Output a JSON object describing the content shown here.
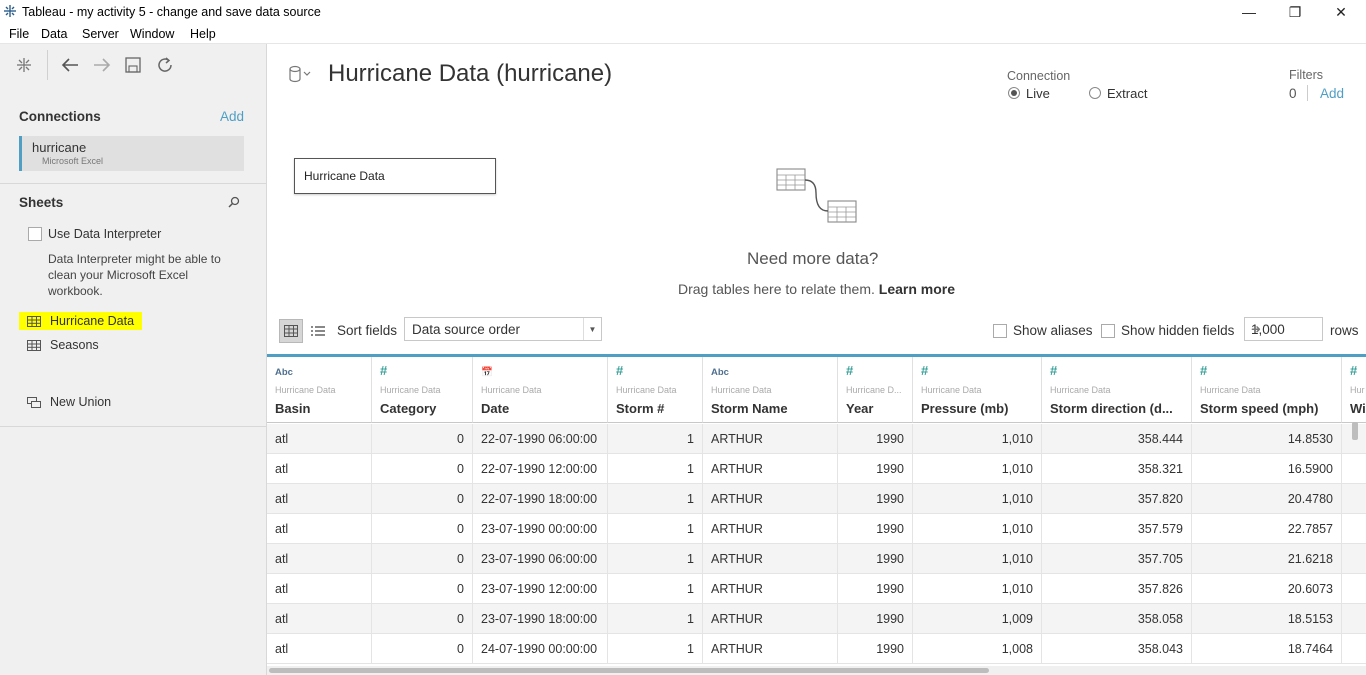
{
  "window": {
    "title": "Tableau - my activity 5 - change and save data source",
    "minimize": "—",
    "restore": "❐",
    "close": "✕"
  },
  "menu": [
    "File",
    "Data",
    "Server",
    "Window",
    "Help"
  ],
  "left": {
    "connections_title": "Connections",
    "connections_add": "Add",
    "connection": {
      "name": "hurricane",
      "type": "Microsoft Excel"
    },
    "sheets_title": "Sheets",
    "use_interpreter": "Use Data Interpreter",
    "interpreter_desc": "Data Interpreter might be able to clean your Microsoft Excel workbook.",
    "sheets": [
      "Hurricane Data",
      "Seasons"
    ],
    "new_union": "New Union"
  },
  "main": {
    "datasource_title": "Hurricane Data (hurricane)",
    "connection_label": "Connection",
    "conn_live": "Live",
    "conn_extract": "Extract",
    "filters_label": "Filters",
    "filters_count": "0",
    "filters_add": "Add",
    "canvas_table": "Hurricane Data",
    "need_more": "Need more data?",
    "drag_text": "Drag tables here to relate them.",
    "learn_more": "Learn more"
  },
  "gridbar": {
    "sort_label": "Sort fields",
    "sort_value": "Data source order",
    "show_aliases": "Show aliases",
    "show_hidden": "Show hidden fields",
    "rows_value": "1,000",
    "rows_label": "rows"
  },
  "grid": {
    "columns": [
      {
        "type": "Abc",
        "kind": "abc",
        "source": "Hurricane Data",
        "name": "Basin",
        "align": "left"
      },
      {
        "type": "#",
        "kind": "num",
        "source": "Hurricane Data",
        "name": "Category",
        "align": "right"
      },
      {
        "type": "📅",
        "kind": "dt",
        "source": "Hurricane Data",
        "name": "Date",
        "align": "left"
      },
      {
        "type": "#",
        "kind": "num",
        "source": "Hurricane Data",
        "name": "Storm #",
        "align": "right"
      },
      {
        "type": "Abc",
        "kind": "abc",
        "source": "Hurricane Data",
        "name": "Storm Name",
        "align": "left"
      },
      {
        "type": "#",
        "kind": "num",
        "source": "Hurricane D...",
        "name": "Year",
        "align": "right"
      },
      {
        "type": "#",
        "kind": "num",
        "source": "Hurricane Data",
        "name": "Pressure (mb)",
        "align": "right"
      },
      {
        "type": "#",
        "kind": "num",
        "source": "Hurricane Data",
        "name": "Storm direction (d...",
        "align": "right"
      },
      {
        "type": "#",
        "kind": "num",
        "source": "Hurricane Data",
        "name": "Storm speed (mph)",
        "align": "right"
      },
      {
        "type": "#",
        "kind": "num",
        "source": "Hur",
        "name": "Wi",
        "align": "left"
      }
    ],
    "rows": [
      [
        "atl",
        "0",
        "22-07-1990 06:00:00",
        "1",
        "ARTHUR",
        "1990",
        "1,010",
        "358.444",
        "14.8530",
        ""
      ],
      [
        "atl",
        "0",
        "22-07-1990 12:00:00",
        "1",
        "ARTHUR",
        "1990",
        "1,010",
        "358.321",
        "16.5900",
        ""
      ],
      [
        "atl",
        "0",
        "22-07-1990 18:00:00",
        "1",
        "ARTHUR",
        "1990",
        "1,010",
        "357.820",
        "20.4780",
        ""
      ],
      [
        "atl",
        "0",
        "23-07-1990 00:00:00",
        "1",
        "ARTHUR",
        "1990",
        "1,010",
        "357.579",
        "22.7857",
        ""
      ],
      [
        "atl",
        "0",
        "23-07-1990 06:00:00",
        "1",
        "ARTHUR",
        "1990",
        "1,010",
        "357.705",
        "21.6218",
        ""
      ],
      [
        "atl",
        "0",
        "23-07-1990 12:00:00",
        "1",
        "ARTHUR",
        "1990",
        "1,010",
        "357.826",
        "20.6073",
        ""
      ],
      [
        "atl",
        "0",
        "23-07-1990 18:00:00",
        "1",
        "ARTHUR",
        "1990",
        "1,009",
        "358.058",
        "18.5153",
        ""
      ],
      [
        "atl",
        "0",
        "24-07-1990 00:00:00",
        "1",
        "ARTHUR",
        "1990",
        "1,008",
        "358.043",
        "18.7464",
        ""
      ]
    ]
  }
}
